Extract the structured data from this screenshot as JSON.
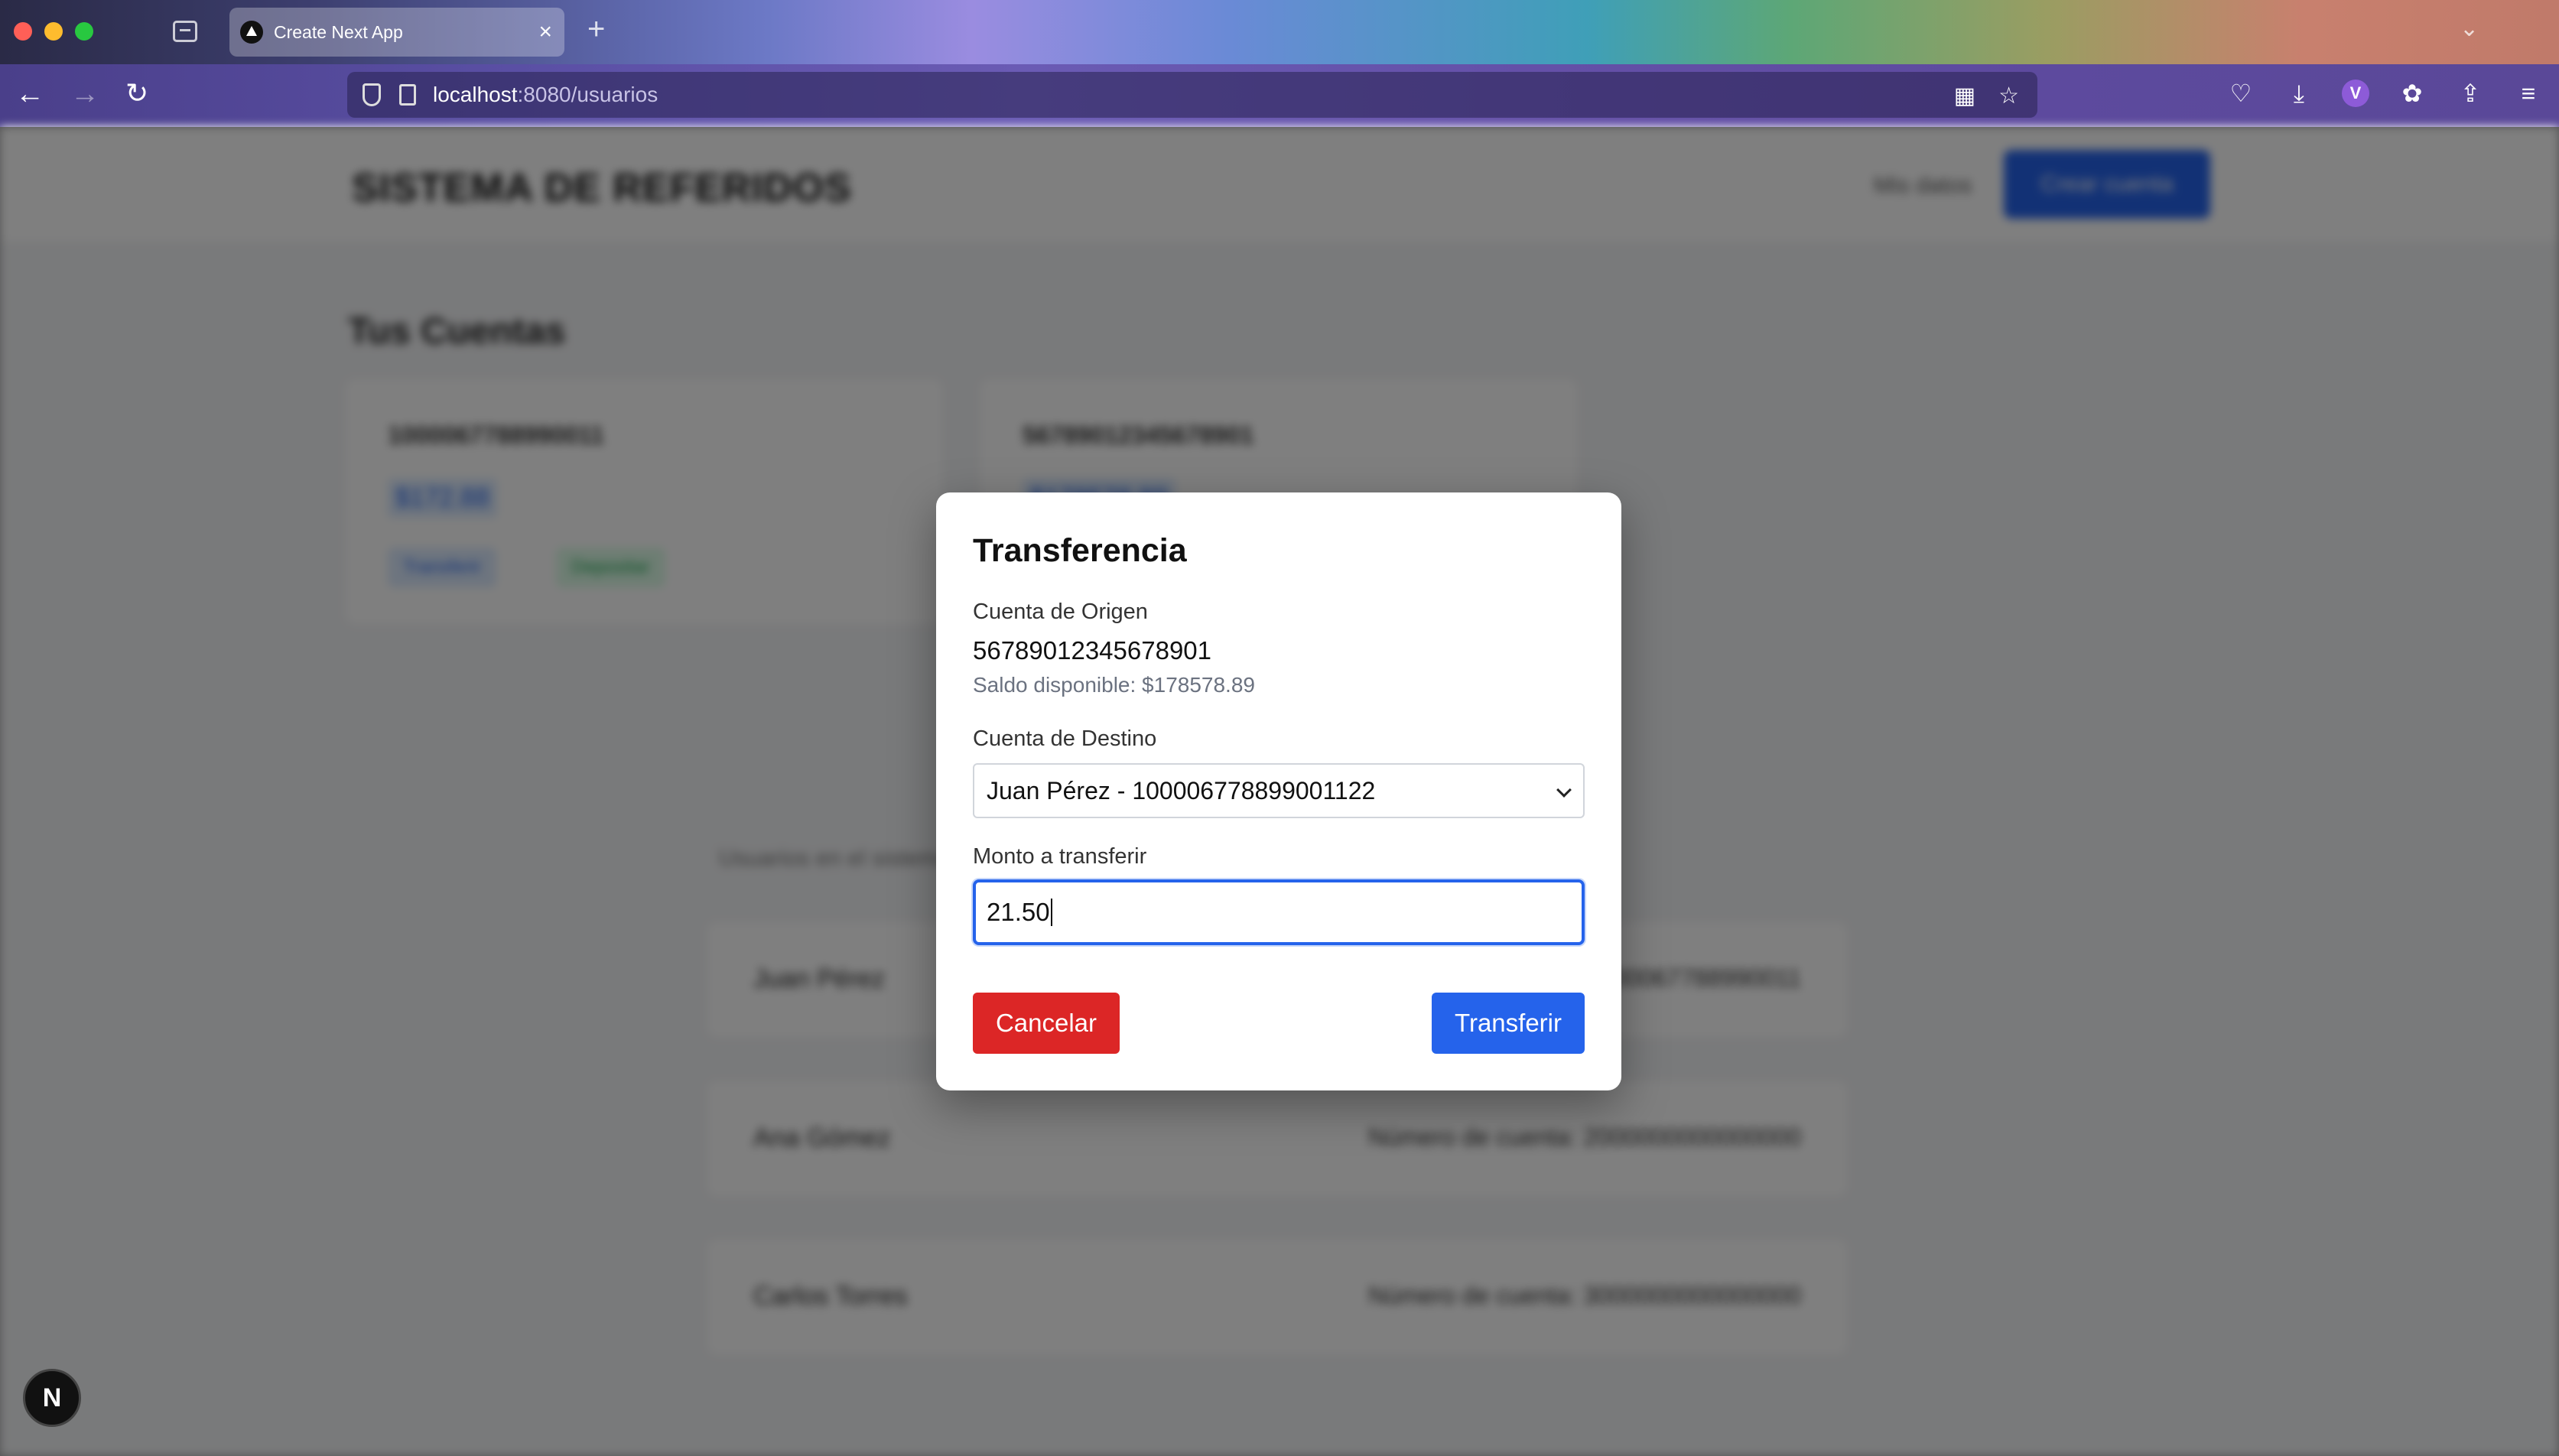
{
  "browser": {
    "tab_title": "Create Next App",
    "tab_close": "×",
    "new_tab": "+",
    "url_host": "localhost",
    "url_path": ":8080/usuarios"
  },
  "page": {
    "app_title": "SISTEMA DE REFERIDOS",
    "header_link": "Mis datos",
    "header_button": "Crear cuenta",
    "section_title": "Tus Cuentas",
    "accounts": [
      {
        "number": "1000067788990011",
        "balance": "$172.88",
        "chips": [
          "Transferir",
          "Depositar"
        ]
      },
      {
        "number": "56789012345678901",
        "balance": "$178578.89",
        "chips": []
      }
    ],
    "users_label": "Usuarios en el sistema",
    "users": [
      {
        "name": "Juan Pérez",
        "info": "Número de cuenta: 1000067788990011"
      },
      {
        "name": "Ana Gómez",
        "info": "Número de cuenta: 2000000000000000"
      },
      {
        "name": "Carlos Torres",
        "info": "Número de cuenta: 3000000000000000"
      }
    ]
  },
  "modal": {
    "title": "Transferencia",
    "origin_label": "Cuenta de Origen",
    "origin_number": "56789012345678901",
    "origin_balance": "Saldo disponible: $178578.89",
    "destination_label": "Cuenta de Destino",
    "destination_selected": "Juan Pérez - 100006778899001122",
    "amount_label": "Monto a transferir",
    "amount_value": "21.50",
    "cancel_label": "Cancelar",
    "transfer_label": "Transferir"
  },
  "next_badge": "N",
  "colors": {
    "primary": "#2563eb",
    "danger": "#dc2626"
  }
}
